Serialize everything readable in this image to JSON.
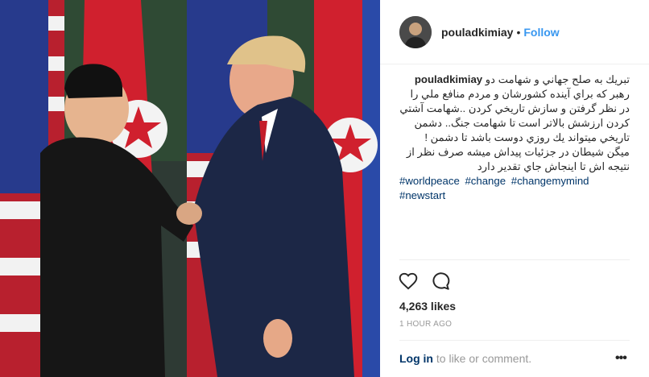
{
  "post": {
    "username": "pouladkimiay",
    "dot": "•",
    "follow_label": "Follow",
    "caption_username": "pouladkimiay",
    "caption_text": "تبريك به صلح جهاني و شهامت دو رهبر كه براي آينده كشورشان و مردم منافع ملي را در نظر گرفتن و سازش تاريخي كردن ..شهامت آشتي كردن ارزشش بالاتر است تا شهامت جنگ.. دشمن تاريخي ميتواند يك روزي دوست باشد تا دشمن ! ميگن شيطان در جزئيات پيداش ميشه صرف نظر از نتيجه اش تا اينجاش جاي تقدير دارد",
    "hashtags": [
      "#worldpeace",
      "#change",
      "#changemymind",
      "#newstart"
    ],
    "likes": "4,263 likes",
    "time": "1 HOUR AGO",
    "login_link": "Log in",
    "login_rest": " to like or comment.",
    "more": "•••"
  },
  "icons": {
    "like": "heart-outline-icon",
    "comment": "speech-bubble-icon",
    "more": "ellipsis-icon"
  },
  "colors": {
    "link_blue": "#3897f0",
    "hashtag": "#003569",
    "muted": "#999999"
  }
}
